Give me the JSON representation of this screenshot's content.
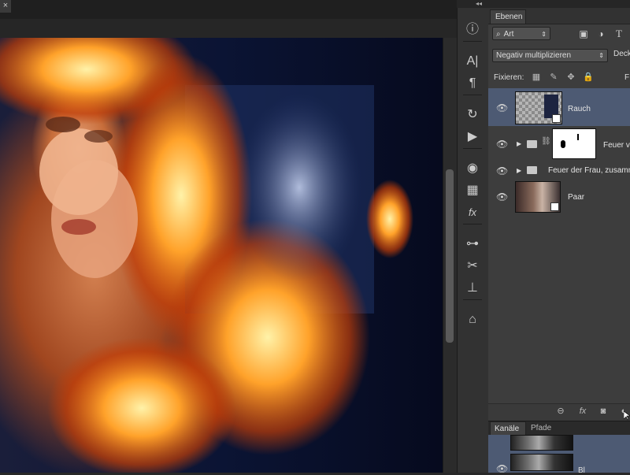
{
  "document": {
    "close_glyph": "×"
  },
  "toolstrip": {
    "collapse_glyph": "◂◂",
    "tools": [
      {
        "name": "info-icon",
        "glyph": "ⓘ"
      },
      {
        "name": "character-icon",
        "glyph": "A|"
      },
      {
        "name": "paragraph-icon",
        "glyph": "¶"
      },
      {
        "name": "history-icon",
        "glyph": "↻"
      },
      {
        "name": "actions-play-icon",
        "glyph": "▶"
      },
      {
        "name": "color-palette-icon",
        "glyph": "◉"
      },
      {
        "name": "swatches-grid-icon",
        "glyph": "▦"
      },
      {
        "name": "styles-fx-icon",
        "glyph": "fx"
      },
      {
        "name": "adjustments-icon",
        "glyph": "⊶"
      },
      {
        "name": "tool-presets-icon",
        "glyph": "✂"
      },
      {
        "name": "clone-source-icon",
        "glyph": "⊥"
      },
      {
        "name": "3d-icon",
        "glyph": "⌂"
      }
    ]
  },
  "layers_panel": {
    "tab_label": "Ebenen",
    "filter_kind": "Art",
    "filter_icons": [
      "image-filter-icon",
      "adjustment-filter-icon",
      "type-filter-icon"
    ],
    "blend_mode": "Negativ multiplizieren",
    "opacity_label": "Deck",
    "lock_label": "Fixieren:",
    "fill_label": "F",
    "layers": [
      {
        "name": "Rauch",
        "visible": true,
        "selected": true,
        "type": "smart-object"
      },
      {
        "name": "Feuer v",
        "visible": true,
        "selected": false,
        "type": "group-with-mask"
      },
      {
        "name": "Feuer der Frau, zusamm",
        "visible": true,
        "selected": false,
        "type": "group"
      },
      {
        "name": "Paar",
        "visible": true,
        "selected": false,
        "type": "smart-object"
      }
    ],
    "footer_icons": [
      "link-icon",
      "fx-icon",
      "mask-icon",
      "adjustment-layer-icon"
    ]
  },
  "channels_panel": {
    "tabs": [
      "Kanäle",
      "Pfade"
    ],
    "active_tab": "Kanäle",
    "rows": [
      {
        "name": ""
      },
      {
        "name": "Bl"
      }
    ]
  },
  "colors": {
    "panel_bg": "#3d3d3d",
    "selected_row": "#4d5a73",
    "app_bg": "#282828"
  }
}
